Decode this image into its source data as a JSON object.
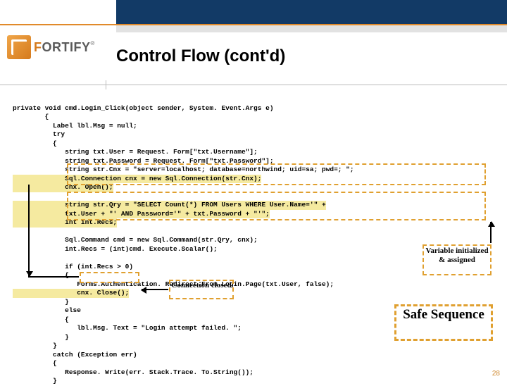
{
  "logo": {
    "prefix": "F",
    "rest": "ORTIFY",
    "reg": "®"
  },
  "title": "Control Flow (cont'd)",
  "code": {
    "l01": "private void cmd.Login_Click(object sender, System. Event.Args e)",
    "l02": "        {",
    "l03": "          Label lbl.Msg = null;",
    "l04": "          try",
    "l05": "          {",
    "l06": "             string txt.User = Request. Form[\"txt.Username\"];",
    "l07": "             string txt.Password = Request. Form[\"txt.Password\"];",
    "l08": "             string str.Cnx = \"server=localhost; database=northwind; uid=sa; pwd=; \";",
    "l09": "             Sql.Connection cnx = new Sql.Connection(str.Cnx);",
    "l10": "             cnx. Open();",
    "l11": "             string str.Qry = \"SELECT Count(*) FROM Users WHERE User.Name='\" +",
    "l12": "             txt.User + \"' AND Password='\" + txt.Password + \"'\";",
    "l13": "             int int.Recs;",
    "l14": "             Sql.Command cmd = new Sql.Command(str.Qry, cnx);",
    "l15": "             int.Recs = (int)cmd. Execute.Scalar();",
    "l16": "             if (int.Recs > 0)",
    "l17": "             {",
    "l18": "                Forms.Authentication. Redirect.From.Login.Page(txt.User, false);",
    "l19": "                cnx. Close();",
    "l20": "             }",
    "l21": "             else",
    "l22": "             {",
    "l23": "                lbl.Msg. Text = \"Login attempt failed. \";",
    "l24": "             }",
    "l25": "          }",
    "l26": "          catch (Exception err)",
    "l27": "          {",
    "l28": "             Response. Write(err. Stack.Trace. To.String());",
    "l29": "          }"
  },
  "annotations": {
    "conn_closed": "Connection\nclosed",
    "var_init": "Variable\ninitialized &\nassigned",
    "safe_seq": "Safe\nSequence"
  },
  "slide_number": "28"
}
